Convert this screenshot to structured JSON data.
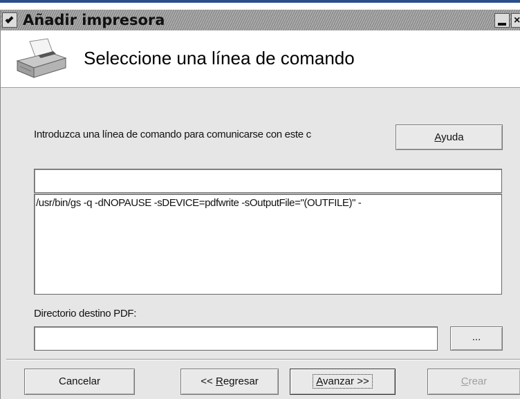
{
  "window": {
    "title": "Añadir impresora",
    "close_glyph": "×"
  },
  "header": {
    "title": "Seleccione una línea de comando",
    "icon": "printer-icon"
  },
  "form": {
    "instruction": "Introduzca una línea de comando para comunicarse con este c",
    "command_top_value": "",
    "command_value": "/usr/bin/gs -q -dNOPAUSE -sDEVICE=pdfwrite -sOutputFile=\"(OUTFILE)\" -",
    "pdf_dir_label": "Directorio destino PDF:",
    "pdf_dir_value": "",
    "browse_label": "..."
  },
  "buttons": {
    "help_prefix": "",
    "help_mnemonic": "A",
    "help_rest": "yuda",
    "cancel": "Cancelar",
    "back_prefix": "<< ",
    "back_mnemonic": "R",
    "back_rest": "egresar",
    "next_mnemonic": "A",
    "next_rest": "vanzar >>",
    "create_mnemonic": "C",
    "create_rest": "rear"
  }
}
